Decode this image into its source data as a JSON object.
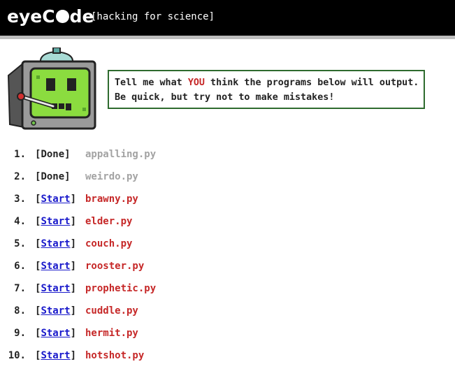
{
  "header": {
    "logo_prefix": "eyeC",
    "logo_suffix": "de",
    "tagline": "[hacking for science]"
  },
  "instructions": {
    "line1_before": "Tell me what ",
    "line1_emphasis": "YOU",
    "line1_after": " think the programs below will output.",
    "line2": "Be quick, but try not to make mistakes!"
  },
  "programs": [
    {
      "number": "1.",
      "status": "Done",
      "file": "appalling.py"
    },
    {
      "number": "2.",
      "status": "Done",
      "file": "weirdo.py"
    },
    {
      "number": "3.",
      "status": "Start",
      "file": "brawny.py"
    },
    {
      "number": "4.",
      "status": "Start",
      "file": "elder.py"
    },
    {
      "number": "5.",
      "status": "Start",
      "file": "couch.py"
    },
    {
      "number": "6.",
      "status": "Start",
      "file": "rooster.py"
    },
    {
      "number": "7.",
      "status": "Start",
      "file": "prophetic.py"
    },
    {
      "number": "8.",
      "status": "Start",
      "file": "cuddle.py"
    },
    {
      "number": "9.",
      "status": "Start",
      "file": "hermit.py"
    },
    {
      "number": "10.",
      "status": "Start",
      "file": "hotshot.py"
    }
  ],
  "colors": {
    "header_bg": "#000000",
    "instruction_border": "#2e6b2e",
    "emphasis": "#c62828",
    "pending_file": "#c62828",
    "done_file": "#a3a3a3",
    "link": "#1a1acb"
  },
  "icons": {
    "mascot": "sick-computer-mascot-icon"
  }
}
